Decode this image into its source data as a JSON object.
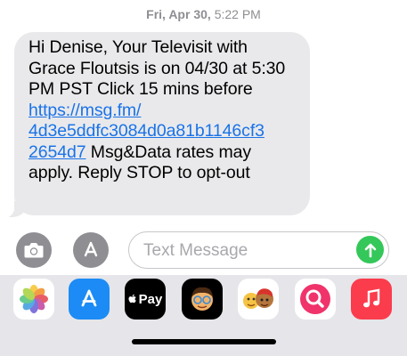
{
  "timestamp": {
    "day": "Fri, Apr 30,",
    "time": "5:22 PM"
  },
  "message": {
    "text_before_link": "Hi Denise, Your Televisit with Grace Floutsis is on 04/30 at 5:30 PM PST Click 15 mins before",
    "link": "https://msg.fm/4d3e5ddfc3084d0a81b1146cf32654d7",
    "link_line1": "https://msg.fm/",
    "link_line2": "4d3e5ddfc3084d0a81b1146cf3",
    "link_line3": "2654d7",
    "text_after_link": " Msg&Data rates may apply. Reply STOP to opt-out"
  },
  "compose": {
    "placeholder": "Text Message",
    "camera_icon": "camera-icon",
    "appstore_icon": "app-store-icon",
    "send_icon": "send-arrow-icon"
  },
  "apps": [
    {
      "name": "Photos",
      "icon": "photos-icon"
    },
    {
      "name": "App Store",
      "icon": "app-store-icon"
    },
    {
      "name": "Apple Pay",
      "icon": "apple-pay-icon",
      "label": "Pay"
    },
    {
      "name": "Memoji",
      "icon": "memoji-icon"
    },
    {
      "name": "Animoji",
      "icon": "animoji-icon"
    },
    {
      "name": "Image Search",
      "icon": "image-search-icon"
    },
    {
      "name": "Music",
      "icon": "music-icon"
    }
  ],
  "colors": {
    "bubble": "#e9e9eb",
    "link": "#1a73e8",
    "send": "#34c759",
    "music": "#fa3c4c",
    "appstore": "#1c8bf5",
    "search": "#f0336a"
  }
}
